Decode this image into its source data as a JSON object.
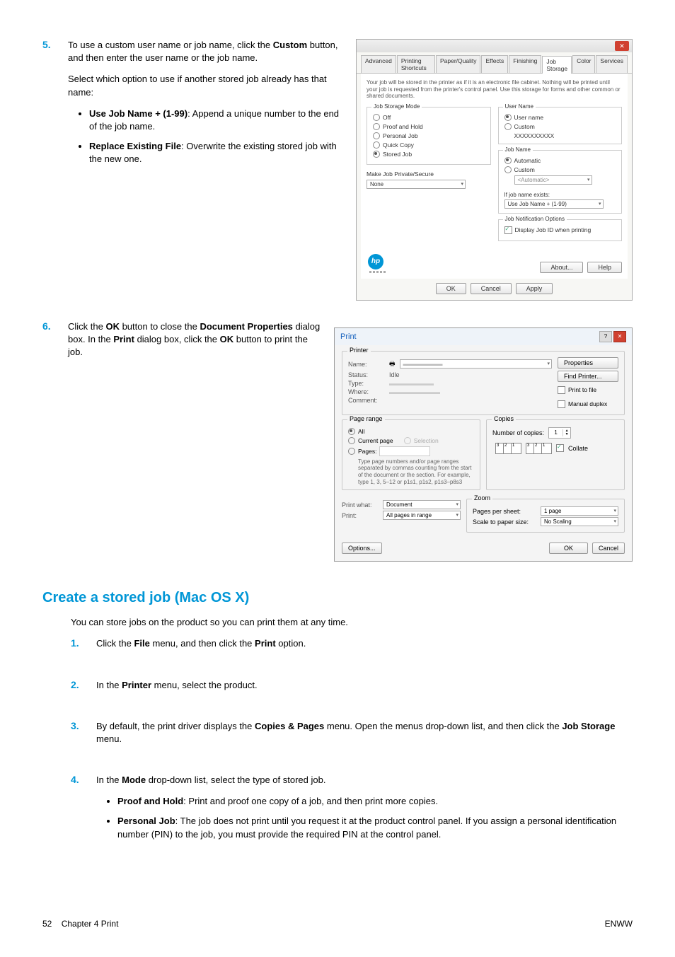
{
  "step5": {
    "num": "5.",
    "p1a": "To use a custom user name or job name, click the ",
    "p1b": "Custom",
    "p1c": " button, and then enter the user name or the job name.",
    "p2": "Select which option to use if another stored job already has that name:",
    "b1a": "Use Job Name + (1-99)",
    "b1b": ": Append a unique number to the end of the job name.",
    "b2a": "Replace Existing File",
    "b2b": ": Overwrite the existing stored job with the new one."
  },
  "step6": {
    "num": "6.",
    "t1": "Click the ",
    "t2": "OK",
    "t3": " button to close the ",
    "t4": "Document Properties",
    "t5": " dialog box. In the ",
    "t6": "Print",
    "t7": " dialog box, click the ",
    "t8": "OK",
    "t9": " button to print the job."
  },
  "dlg1": {
    "tabs": [
      "Advanced",
      "Printing Shortcuts",
      "Paper/Quality",
      "Effects",
      "Finishing",
      "Job Storage",
      "Color",
      "Services"
    ],
    "active_tab": 5,
    "info": "Your job will be stored in the printer as if it is an electronic file cabinet. Nothing will be printed until your job is requested from the printer's control panel. Use this storage for forms and other common or shared documents.",
    "jsm_label": "Job Storage Mode",
    "jsm_opts": [
      "Off",
      "Proof and Hold",
      "Personal Job",
      "Quick Copy",
      "Stored Job"
    ],
    "jsm_sel": 4,
    "priv_label": "Make Job Private/Secure",
    "priv_val": "None",
    "un_label": "User Name",
    "un_opts": [
      "User name",
      "Custom"
    ],
    "un_val": "XXXXXXXXXX",
    "jn_label": "Job Name",
    "jn_opts": [
      "Automatic",
      "Custom"
    ],
    "jn_val": "<Automatic>",
    "exists_label": "If job name exists:",
    "exists_val": "Use Job Name + (1-99)",
    "notif_label": "Job Notification Options",
    "notif_chk": "Display Job ID when printing",
    "btn_about": "About...",
    "btn_help": "Help",
    "btn_ok": "OK",
    "btn_cancel": "Cancel",
    "btn_apply": "Apply"
  },
  "pd": {
    "title": "Print",
    "printer": "Printer",
    "name_lbl": "Name:",
    "status_lbl": "Status:",
    "status_val": "Idle",
    "type_lbl": "Type:",
    "where_lbl": "Where:",
    "comment_lbl": "Comment:",
    "btn_props": "Properties",
    "btn_find": "Find Printer...",
    "chk_file": "Print to file",
    "chk_dup": "Manual duplex",
    "pr_label": "Page range",
    "pr_all": "All",
    "pr_cur": "Current page",
    "pr_sel": "Selection",
    "pr_pages": "Pages:",
    "pr_help": "Type page numbers and/or page ranges separated by commas counting from the start of the document or the section. For example, type 1, 3, 5–12 or p1s1, p1s2, p1s3–p8s3",
    "cop_label": "Copies",
    "cop_num_lbl": "Number of copies:",
    "cop_num": "1",
    "collate": "Collate",
    "pw_lbl": "Print what:",
    "pw_val": "Document",
    "pr_lbl": "Print:",
    "pr_val": "All pages in range",
    "zoom": "Zoom",
    "pps_lbl": "Pages per sheet:",
    "pps_val": "1 page",
    "sps_lbl": "Scale to paper size:",
    "sps_val": "No Scaling",
    "btn_opt": "Options...",
    "btn_ok": "OK",
    "btn_cancel": "Cancel"
  },
  "h2": "Create a stored job (Mac OS X)",
  "intro": "You can store jobs on the product so you can print them at any time.",
  "mac": {
    "s1n": "1.",
    "s1a": "Click the ",
    "s1b": "File",
    "s1c": " menu, and then click the ",
    "s1d": "Print",
    "s1e": " option.",
    "s2n": "2.",
    "s2a": "In the ",
    "s2b": "Printer",
    "s2c": " menu, select the product.",
    "s3n": "3.",
    "s3a": "By default, the print driver displays the ",
    "s3b": "Copies & Pages",
    "s3c": " menu. Open the menus drop-down list, and then click the ",
    "s3d": "Job Storage",
    "s3e": " menu.",
    "s4n": "4.",
    "s4a": "In the ",
    "s4b": "Mode",
    "s4c": " drop-down list, select the type of stored job.",
    "b1a": "Proof and Hold",
    "b1b": ": Print and proof one copy of a job, and then print more copies.",
    "b2a": "Personal Job",
    "b2b": ": The job does not print until you request it at the product control panel. If you assign a personal identification number (PIN) to the job, you must provide the required PIN at the control panel."
  },
  "footer": {
    "left_a": "52",
    "left_b": "Chapter 4   Print",
    "right": "ENWW"
  }
}
